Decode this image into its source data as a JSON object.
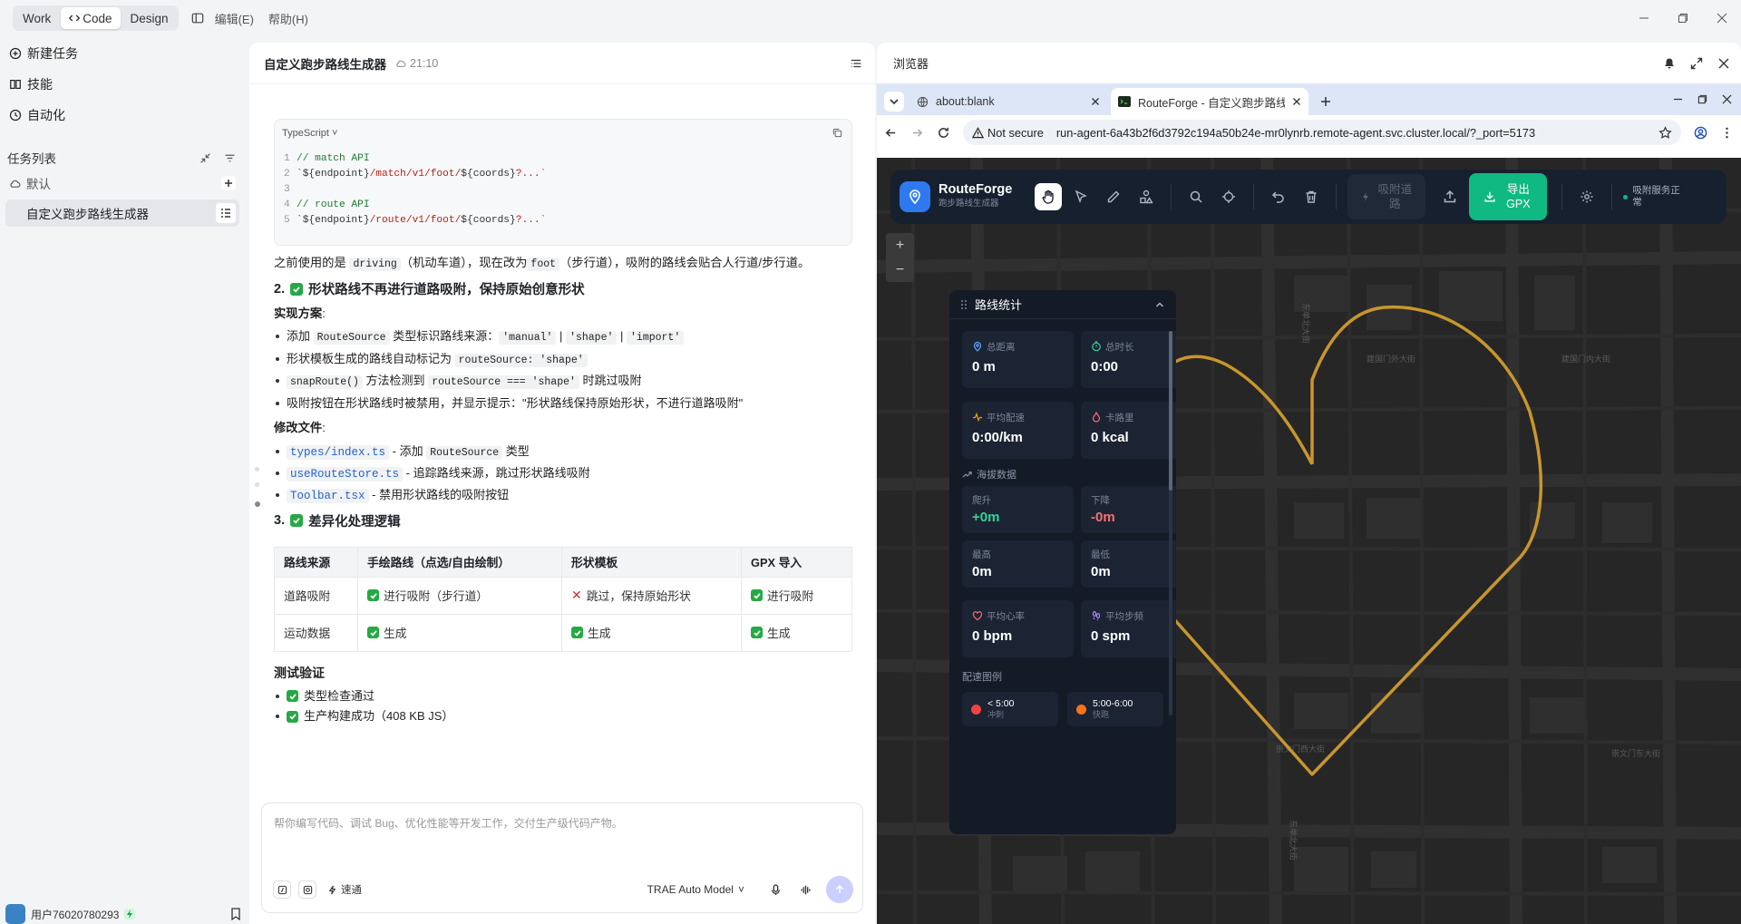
{
  "topbar": {
    "modes": [
      "Work",
      "Code",
      "Design"
    ],
    "active_mode": "Code",
    "menu": [
      "编辑(E)",
      "帮助(H)"
    ]
  },
  "sidebar": {
    "nav": [
      {
        "icon": "plus-circle-icon",
        "label": "新建任务"
      },
      {
        "icon": "book-icon",
        "label": "技能"
      },
      {
        "icon": "clock-icon",
        "label": "自动化"
      }
    ],
    "tasks_title": "任务列表",
    "group_label": "默认",
    "task_label": "自定义跑步路线生成器",
    "user_label": "用户76020780293"
  },
  "chat": {
    "title": "自定义跑步路线生成器",
    "time": "21:10",
    "code_block": {
      "lang": "TypeScript",
      "lines": [
        {
          "n": "1",
          "comment": "// match API"
        },
        {
          "n": "2",
          "pre": "`${endpoint}",
          "path": "/match/v1/foot/",
          "post": "${coords}",
          "tail": "?...`"
        },
        {
          "n": "3"
        },
        {
          "n": "4",
          "comment": "// route API"
        },
        {
          "n": "5",
          "pre": "`${endpoint}",
          "path": "/route/v1/foot/",
          "post": "${coords}",
          "tail": "?...`"
        }
      ]
    },
    "p1": {
      "a": "之前使用的是",
      "c1": "driving",
      "b": "（机动车道），现在改为",
      "c2": "foot",
      "d": "（步行道），吸附的路线会贴合人行道/步行道。"
    },
    "h2": {
      "num": "2.",
      "text": "形状路线不再进行道路吸附，保持原始创意形状"
    },
    "impl_label": "实现方案",
    "colon": ":",
    "impl": {
      "i1": {
        "a": "添加",
        "c": "RouteSource",
        "b": "类型标识路线来源：",
        "o1": "'manual'",
        "sep": "|",
        "o2": "'shape'",
        "o3": "'import'"
      },
      "i2": {
        "a": "形状模板生成的路线自动标记为",
        "c": "routeSource: 'shape'"
      },
      "i3": {
        "c1": "snapRoute()",
        "a": "方法检测到",
        "c2": "routeSource === 'shape'",
        "b": "时跳过吸附"
      },
      "i4": "吸附按钮在形状路线时被禁用，并显示提示：\"形状路线保持原始形状，不进行道路吸附\""
    },
    "files_label": "修改文件",
    "files": [
      {
        "file": "types/index.ts",
        "a": "- 添加",
        "c": "RouteSource",
        "b": "类型"
      },
      {
        "file": "useRouteStore.ts",
        "a": "- 追踪路线来源，跳过形状路线吸附"
      },
      {
        "file": "Toolbar.tsx",
        "a": "- 禁用形状路线的吸附按钮"
      }
    ],
    "h3": {
      "num": "3.",
      "text": "差异化处理逻辑"
    },
    "table": {
      "headers": [
        "路线来源",
        "手绘路线（点选/自由绘制）",
        "形状模板",
        "GPX 导入"
      ],
      "rows": [
        [
          "道路吸附",
          "进行吸附（步行道）",
          "跳过，保持原始形状",
          "进行吸附"
        ],
        [
          "运动数据",
          "生成",
          "生成",
          "生成"
        ]
      ]
    },
    "test_title": "测试验证",
    "tests": [
      "类型检查通过",
      "生产构建成功（408 KB JS）"
    ],
    "input": {
      "placeholder": "帮你编写代码、调试 Bug、优化性能等开发工作，交付生产级代码产物。",
      "speed_label": "速通",
      "model": "TRAE Auto Model"
    }
  },
  "browser": {
    "title": "浏览器",
    "tabs": [
      {
        "label": "about:blank",
        "active": false
      },
      {
        "label": "RouteForge - 自定义跑步路线",
        "active": true
      }
    ],
    "not_secure": "Not secure",
    "url": "run-agent-6a43b2f6d3792c194a50b24e-mr0lynrb.remote-agent.svc.cluster.local/?_port=5173",
    "app": {
      "name": "RouteForge",
      "subtitle": "跑步路线生成器",
      "snap_label": "吸附道路",
      "export_label": "导出 GPX",
      "status": "吸附服务正常",
      "zoom_in": "+",
      "zoom_out": "−"
    },
    "stats": {
      "title": "路线统计",
      "cards": [
        {
          "icon": "pin-icon",
          "label": "总距离",
          "value": "0 m"
        },
        {
          "icon": "timer-icon",
          "label": "总时长",
          "value": "0:00"
        },
        {
          "icon": "pulse-icon",
          "label": "平均配速",
          "value": "0:00/km"
        },
        {
          "icon": "flame-icon",
          "label": "卡路里",
          "value": "0 kcal"
        }
      ],
      "elevation_title": "海拔数据",
      "elev": [
        {
          "label": "爬升",
          "value": "+0m",
          "color": "#34d399"
        },
        {
          "label": "下降",
          "value": "-0m",
          "color": "#f87171"
        },
        {
          "label": "最高",
          "value": "0m",
          "color": "#ffffff"
        },
        {
          "label": "最低",
          "value": "0m",
          "color": "#ffffff"
        }
      ],
      "hr": {
        "icon": "heart-icon",
        "label": "平均心率",
        "value": "0 bpm"
      },
      "cadence": {
        "icon": "footprints-icon",
        "label": "平均步频",
        "value": "0 spm"
      },
      "legend_title": "配速图例",
      "legend": [
        {
          "label": "< 5:00",
          "sub": "冲刺",
          "color": "#ef4444"
        },
        {
          "label": "5:00-6:00",
          "sub": "快跑",
          "color": "#f97316"
        }
      ]
    },
    "map_labels": [
      "建国门内大街",
      "建国门外大街",
      "崇文门西大街",
      "崇文门东大街",
      "东单北大街",
      "东单北大街"
    ],
    "route_color": "#c8962c"
  }
}
